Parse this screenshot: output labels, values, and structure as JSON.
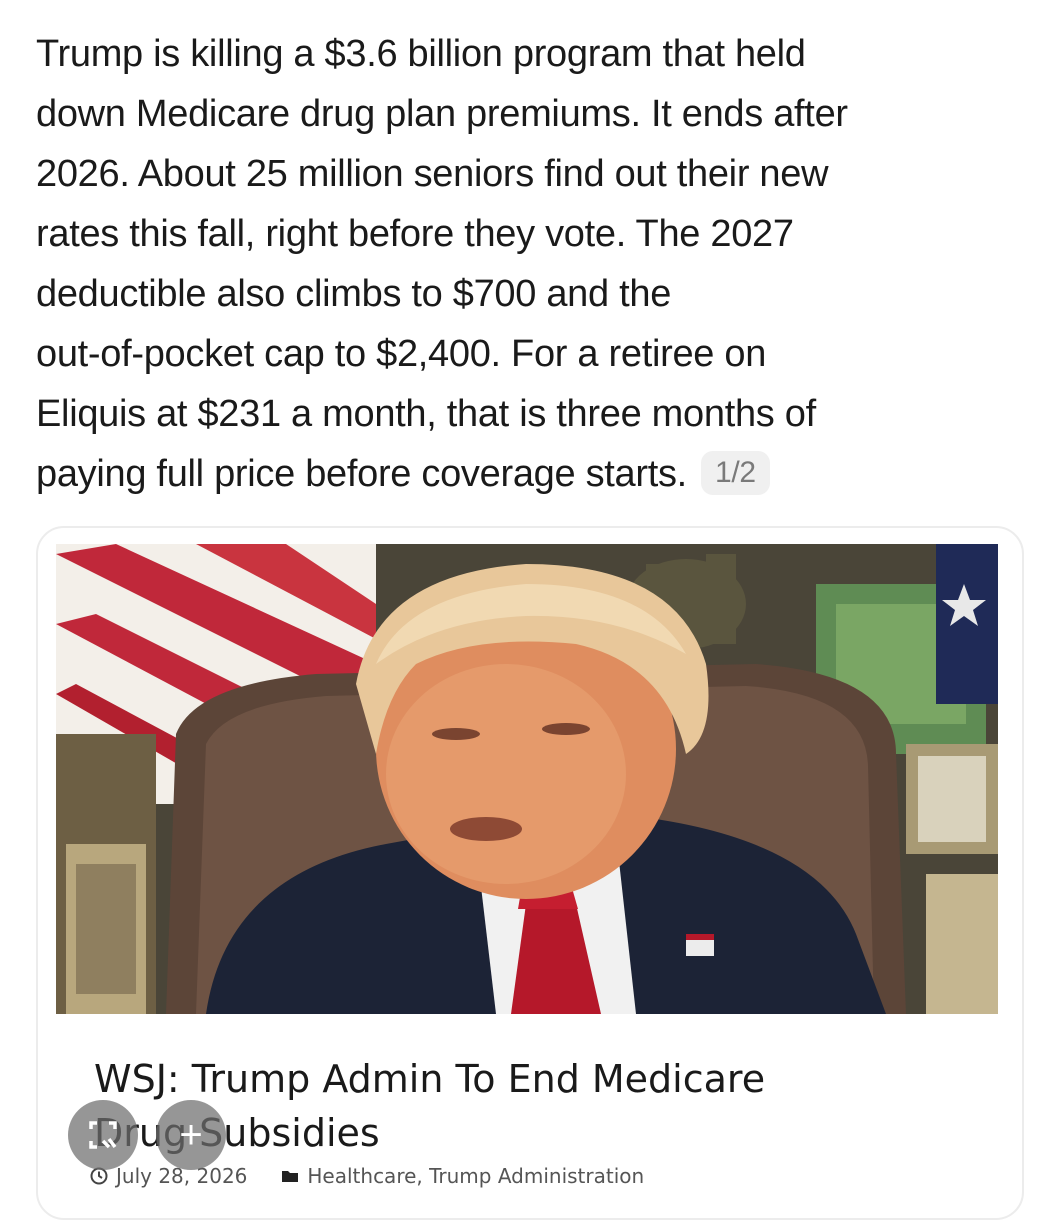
{
  "post": {
    "lines": [
      "Trump is killing a $3.6 billion program that held",
      "down Medicare drug plan premiums. It ends after",
      "2026. About 25 million seniors find out their new",
      "rates this fall, right before they vote. The 2027",
      "deductible also climbs to $700 and the",
      "out-of-pocket cap to $2,400. For a retiree on",
      "Eliquis at $231 a month, that is three months of",
      "paying full price before coverage starts."
    ],
    "page_indicator": "1/2"
  },
  "card": {
    "headline_line1": "WSJ: Trump Admin To End Medicare",
    "headline_line2": "Drug Subsidies",
    "date": "July 28, 2026",
    "categories": "Healthcare, Trump Administration",
    "icons": {
      "date": "clock-icon",
      "category": "folder-icon"
    }
  },
  "overlay": {
    "left_button_icon": "visual-search-icon",
    "right_button_icon": "plus-icon",
    "right_button_glyph": "+"
  },
  "colors": {
    "text": "#1a1a1a",
    "badge_bg": "#f0f0f0",
    "badge_text": "#7a7a7a",
    "meta_text": "#555555"
  }
}
